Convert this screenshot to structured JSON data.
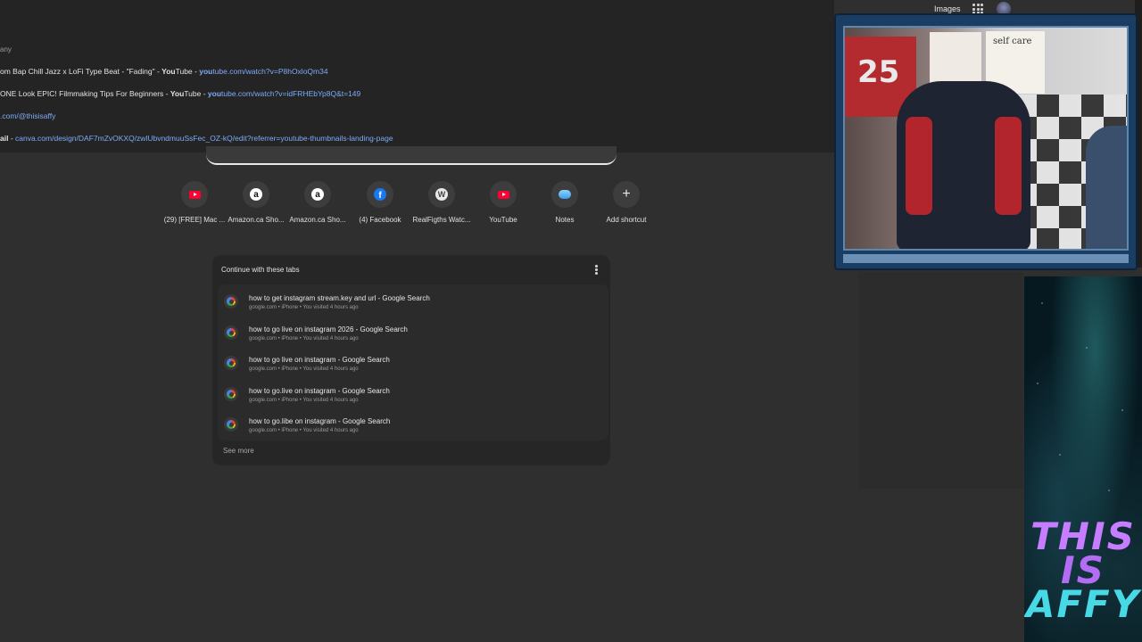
{
  "topbar": {
    "images_label": "Images"
  },
  "omnibox": {
    "fragment": "any",
    "suggestions": [
      {
        "pre": "om Bap Chill Jazz x LoFi Type Beat - \"Fading\" - ",
        "bold": "You",
        "post": "Tube",
        "sep": " - ",
        "url_bold": "you",
        "url": "tube.com/watch?v=P8hOxloQm34"
      },
      {
        "pre": "ONE Look EPIC! Filmmaking Tips For Beginners - ",
        "bold": "You",
        "post": "Tube",
        "sep": " - ",
        "url_bold": "you",
        "url": "tube.com/watch?v=idFRHEbYp8Q&t=149"
      },
      {
        "pre": "",
        "bold": "",
        "post": "",
        "sep": "",
        "url_bold": "",
        "url": ".com/@thisisaffy"
      },
      {
        "pre": "ail",
        "bold": "",
        "post": "",
        "sep": " - ",
        "url_bold": "",
        "url": "canva.com/design/DAF7mZvOKXQ/zwlUbvndmuuSsFec_OZ-kQ/edit?referrer=youtube-thumbnails-landing-page"
      }
    ]
  },
  "shortcuts": [
    {
      "label": "(29) [FREE] Mac ...",
      "icon": "youtube-icon"
    },
    {
      "label": "Amazon.ca Sho...",
      "icon": "amazon-icon",
      "glyph": "a"
    },
    {
      "label": "Amazon.ca Sho...",
      "icon": "amazon-icon",
      "glyph": "a"
    },
    {
      "label": "(4) Facebook",
      "icon": "facebook-icon",
      "glyph": "f"
    },
    {
      "label": "RealFigths Watc...",
      "icon": "wordpress-icon",
      "glyph": "W"
    },
    {
      "label": "YouTube",
      "icon": "youtube-icon"
    },
    {
      "label": "Notes",
      "icon": "cloud-icon"
    },
    {
      "label": "Add shortcut",
      "icon": "plus-icon",
      "glyph": "+"
    }
  ],
  "continue_card": {
    "title": "Continue with these tabs",
    "tabs": [
      {
        "title": "how to get instagram stream.key and url - Google Search",
        "meta": "google.com • iPhone • You visited 4 hours ago"
      },
      {
        "title": "how to go live on instagram 2026 - Google Search",
        "meta": "google.com • iPhone • You visited 4 hours ago"
      },
      {
        "title": "how to go live on instagram - Google Search",
        "meta": "google.com • iPhone • You visited 4 hours ago"
      },
      {
        "title": "how to go.live on instagram - Google Search",
        "meta": "google.com • iPhone • You visited 4 hours ago"
      },
      {
        "title": "how to go.libe on instagram - Google Search",
        "meta": "google.com • iPhone • You visited 4 hours ago"
      }
    ],
    "see_more": "See more"
  },
  "webcam": {
    "sign_text": "self care",
    "jersey_number": "25"
  },
  "overlay": {
    "line1": "THIS",
    "line2": "IS",
    "line3": "AFFY"
  }
}
